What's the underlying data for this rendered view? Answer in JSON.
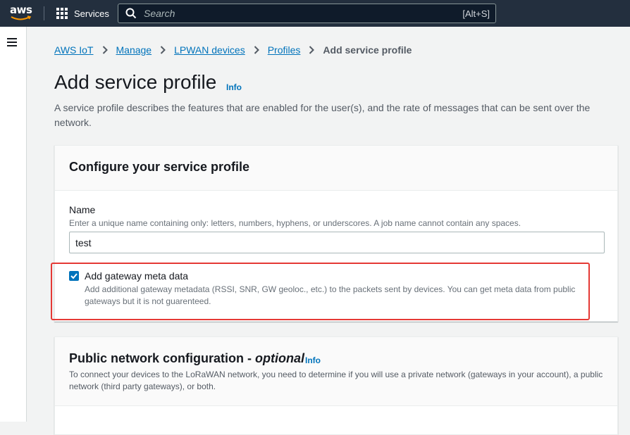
{
  "header": {
    "logo_text": "aws",
    "services_label": "Services",
    "search_placeholder": "Search",
    "search_shortcut": "[Alt+S]"
  },
  "breadcrumb": {
    "items": [
      "AWS IoT",
      "Manage",
      "LPWAN devices",
      "Profiles"
    ],
    "current": "Add service profile"
  },
  "page": {
    "title": "Add service profile",
    "info_link": "Info",
    "description": "A service profile describes the features that are enabled for the user(s), and the rate of messages that can be sent over the network."
  },
  "configure_section": {
    "title": "Configure your service profile",
    "name_label": "Name",
    "name_help": "Enter a unique name containing only: letters, numbers, hyphens, or underscores. A job name cannot contain any spaces.",
    "name_value": "test",
    "gateway_checkbox_label": "Add gateway meta data",
    "gateway_checkbox_checked": true,
    "gateway_checkbox_desc": "Add additional gateway metadata (RSSI, SNR, GW geoloc., etc.) to the packets sent by devices. You can get meta data from public gateways but it is not guarenteed."
  },
  "public_network_section": {
    "title": "Public network configuration - ",
    "title_optional": "optional",
    "info_link": "Info",
    "description": "To connect your devices to the LoRaWAN network, you need to determine if you will use a private network (gateways in your account), a public network (third party gateways), or both."
  },
  "colors": {
    "header_bg": "#232f3e",
    "link": "#0073bb",
    "highlight_border": "#e53935",
    "aws_smile": "#ff9900"
  }
}
